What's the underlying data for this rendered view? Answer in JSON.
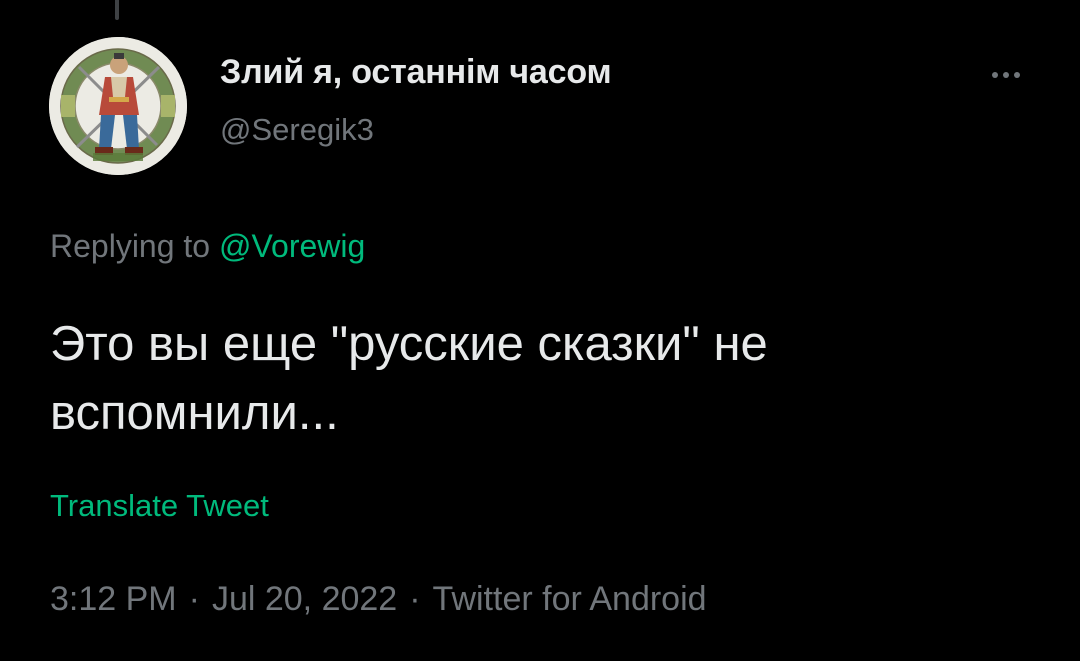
{
  "tweet": {
    "display_name": "Злий я, останнім часом",
    "handle": "@Seregik3",
    "replying_prefix": "Replying to",
    "replying_mention": "@Vorewig",
    "text": "Это вы еще \"русские сказки\" не вспомнили...",
    "translate_label": "Translate Tweet",
    "time": "3:12 PM",
    "date": "Jul 20, 2022",
    "separator": "·",
    "source": "Twitter for Android"
  },
  "icons": {
    "more": "more-horizontal-icon",
    "avatar": "cossack-emblem-avatar"
  },
  "colors": {
    "background": "#000000",
    "text_primary": "#e7e9ea",
    "text_secondary": "#71767b",
    "accent": "#00ba7c"
  }
}
